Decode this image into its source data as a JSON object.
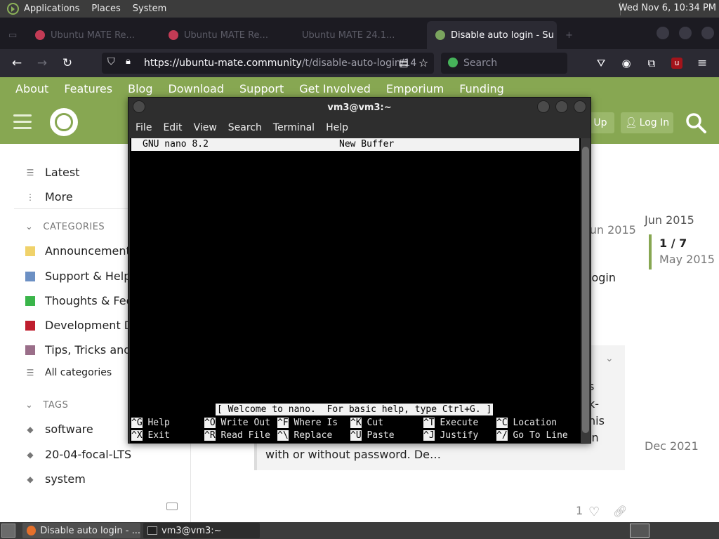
{
  "top_panel": {
    "menus": [
      "Applications",
      "Places",
      "System"
    ],
    "clock": "Wed Nov  6, 10:34 PM"
  },
  "browser": {
    "tabs": [
      {
        "label": "Ubuntu MATE Re...",
        "active": false
      },
      {
        "label": "Ubuntu MATE Re...",
        "active": false
      },
      {
        "label": "Ubuntu MATE 24.1...",
        "active": false
      },
      {
        "label": "Disable auto login - Su",
        "active": true
      }
    ],
    "url_main": "https://ubuntu-mate.community",
    "url_path": "/t/disable-auto-login/14",
    "search_placeholder": "Search"
  },
  "site": {
    "menu": [
      "About",
      "Features",
      "Blog",
      "Download",
      "Support",
      "Get Involved",
      "Emporium",
      "Funding"
    ],
    "signup_frag": "Up",
    "login": "Log In",
    "brand_color": "#87a752"
  },
  "sidebar": {
    "latest": "Latest",
    "more": "More",
    "categories_head": "CATEGORIES",
    "categories": [
      {
        "label": "Announcements",
        "color": "#f0d26a"
      },
      {
        "label": "Support & Help",
        "color": "#6c90c4"
      },
      {
        "label": "Thoughts & Feedback",
        "color": "#3ab54a"
      },
      {
        "label": "Development Discussion",
        "color": "#bf1e2e"
      },
      {
        "label": "Tips, Tricks and Tutorials",
        "color": "#9a6e89"
      }
    ],
    "all_categories": "All categories",
    "tags_head": "TAGS",
    "tags": [
      "software",
      "20-04-focal-LTS",
      "system"
    ]
  },
  "content": {
    "post_date": "Jun 2015",
    "title_frag": "login",
    "excerpt_frags": [
      "s",
      "k-",
      "his",
      "in"
    ],
    "excerpt_last": "with or without password. De…",
    "likes": "1",
    "timeline_start": "Jun 2015",
    "timeline_count": "1 / 7",
    "timeline_current": "May 2015",
    "timeline_end": "Dec 2021"
  },
  "terminal": {
    "title": "vm3@vm3:~",
    "menu": [
      "File",
      "Edit",
      "View",
      "Search",
      "Terminal",
      "Help"
    ],
    "nano_version": "GNU nano 8.2",
    "buffer_name": "New Buffer",
    "status": "[ Welcome to nano.  For basic help, type Ctrl+G. ]",
    "shortcuts_row1": [
      {
        "key": "^G",
        "label": "Help"
      },
      {
        "key": "^O",
        "label": "Write Out"
      },
      {
        "key": "^F",
        "label": "Where Is"
      },
      {
        "key": "^K",
        "label": "Cut"
      },
      {
        "key": "^T",
        "label": "Execute"
      },
      {
        "key": "^C",
        "label": "Location"
      }
    ],
    "shortcuts_row2": [
      {
        "key": "^X",
        "label": "Exit"
      },
      {
        "key": "^R",
        "label": "Read File"
      },
      {
        "key": "^\\",
        "label": "Replace"
      },
      {
        "key": "^U",
        "label": "Paste"
      },
      {
        "key": "^J",
        "label": "Justify"
      },
      {
        "key": "^/",
        "label": "Go To Line"
      }
    ]
  },
  "taskbar": {
    "tasks": [
      "Disable auto login - ...",
      "vm3@vm3:~"
    ]
  }
}
